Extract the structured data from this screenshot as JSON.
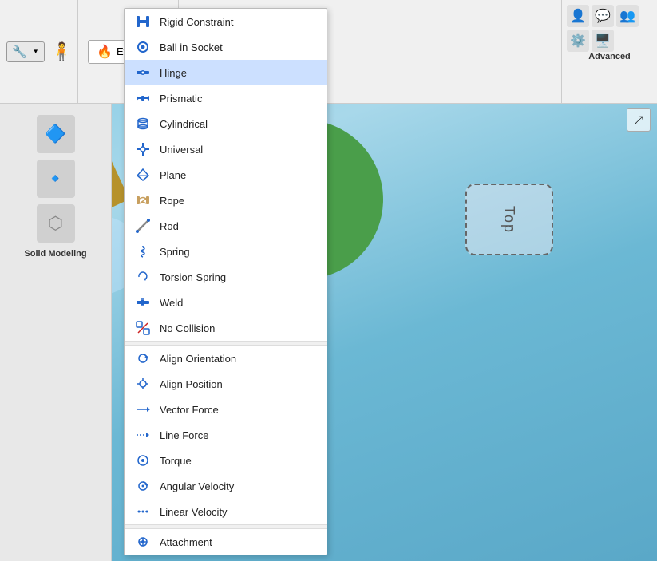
{
  "app": {
    "title": "Solid Modeling"
  },
  "toolbar": {
    "effects_label": "Effects",
    "advanced_label": "Advanced",
    "dropdown_arrow": "▼"
  },
  "menu": {
    "items": [
      {
        "id": "rigid-constraint",
        "label": "Rigid Constraint",
        "icon": "⊞",
        "icon_type": "grid",
        "active": false
      },
      {
        "id": "ball-in-socket",
        "label": "Ball in Socket",
        "icon": "⊙",
        "icon_type": "circle",
        "active": false
      },
      {
        "id": "hinge",
        "label": "Hinge",
        "icon": "◈",
        "icon_type": "hinge",
        "active": true
      },
      {
        "id": "prismatic",
        "label": "Prismatic",
        "icon": "⟺",
        "icon_type": "arrows",
        "active": false
      },
      {
        "id": "cylindrical",
        "label": "Cylindrical",
        "icon": "⬡",
        "icon_type": "hex",
        "active": false
      },
      {
        "id": "universal",
        "label": "Universal",
        "icon": "✦",
        "icon_type": "star",
        "active": false
      },
      {
        "id": "plane",
        "label": "Plane",
        "icon": "◇",
        "icon_type": "diamond",
        "active": false
      },
      {
        "id": "rope",
        "label": "Rope",
        "icon": "≋",
        "icon_type": "wave",
        "active": false
      },
      {
        "id": "rod",
        "label": "Rod",
        "icon": "╱",
        "icon_type": "slash",
        "active": false
      },
      {
        "id": "spring",
        "label": "Spring",
        "icon": "⌇",
        "icon_type": "spring",
        "active": false
      },
      {
        "id": "torsion-spring",
        "label": "Torsion Spring",
        "icon": "↺",
        "icon_type": "rotate",
        "active": false
      },
      {
        "id": "weld",
        "label": "Weld",
        "icon": "⊠",
        "icon_type": "weld",
        "active": false
      },
      {
        "id": "no-collision",
        "label": "No Collision",
        "icon": "⊡",
        "icon_type": "nocol",
        "active": false
      }
    ],
    "items2": [
      {
        "id": "align-orientation",
        "label": "Align Orientation",
        "icon": "↻",
        "icon_type": "orient",
        "active": false
      },
      {
        "id": "align-position",
        "label": "Align Position",
        "icon": "+",
        "icon_type": "plus",
        "active": false
      },
      {
        "id": "vector-force",
        "label": "Vector Force",
        "icon": "→",
        "icon_type": "arrow-right",
        "active": false
      },
      {
        "id": "line-force",
        "label": "Line Force",
        "icon": "⇢",
        "icon_type": "arrow-right2",
        "active": false
      },
      {
        "id": "torque",
        "label": "Torque",
        "icon": "◎",
        "icon_type": "circle2",
        "active": false
      },
      {
        "id": "angular-velocity",
        "label": "Angular Velocity",
        "icon": "↺",
        "icon_type": "rotate2",
        "active": false
      },
      {
        "id": "linear-velocity",
        "label": "Linear Velocity",
        "icon": "⋯",
        "icon_type": "dots",
        "active": false
      }
    ],
    "items3": [
      {
        "id": "attachment",
        "label": "Attachment",
        "icon": "⊕",
        "icon_type": "attach",
        "active": false
      }
    ]
  },
  "viewport": {
    "label": "Top",
    "expand_icon": "⤢"
  },
  "sidebar": {
    "label": "Solid Modeling",
    "icons": [
      "🔷",
      "🔹",
      "🔵"
    ]
  }
}
